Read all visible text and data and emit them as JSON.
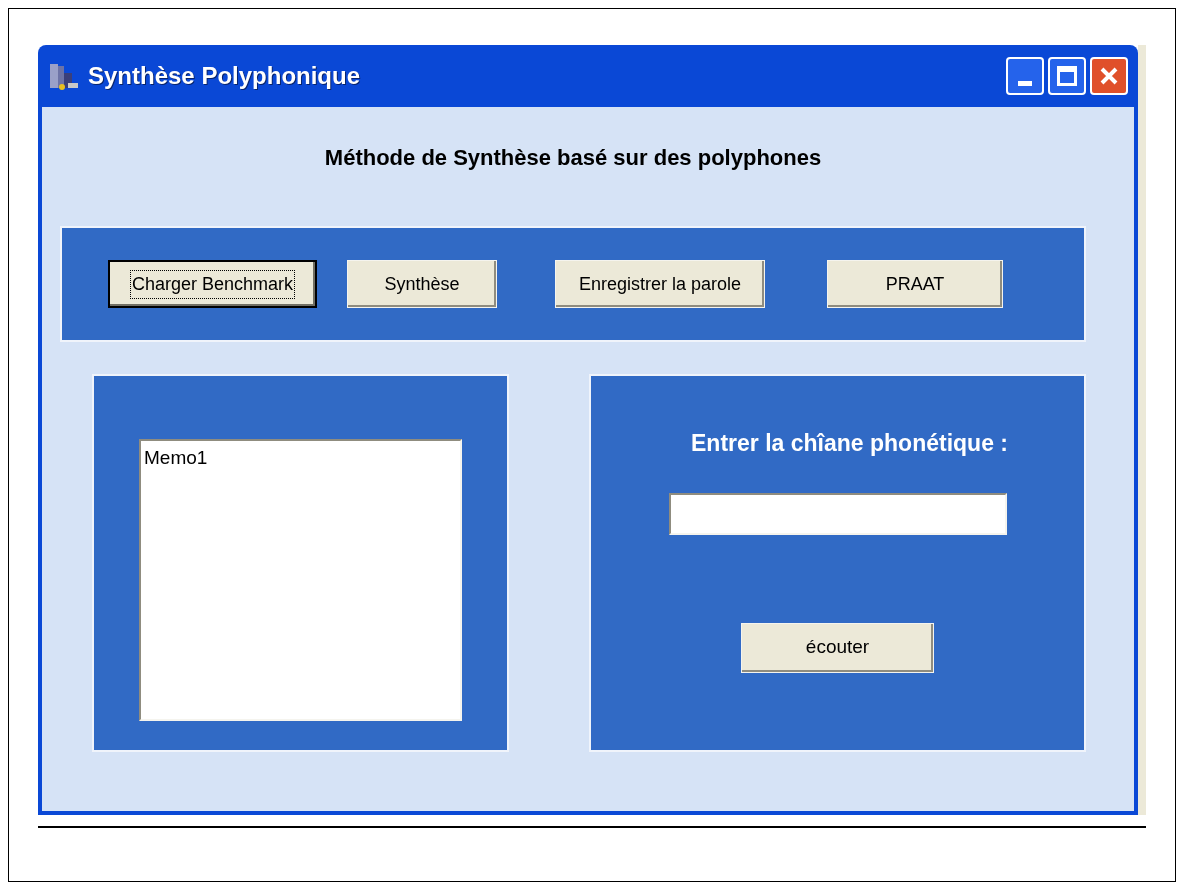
{
  "window": {
    "title": "Synthèse Polyphonique"
  },
  "heading": "Méthode de Synthèse basé sur des polyphones",
  "toolbar": {
    "buttons": [
      {
        "label": "Charger Benchmark",
        "focused": true
      },
      {
        "label": "Synthèse",
        "focused": false
      },
      {
        "label": "Enregistrer la parole",
        "focused": false
      },
      {
        "label": "PRAAT",
        "focused": false
      }
    ]
  },
  "memo": {
    "value": "Memo1"
  },
  "phonetic": {
    "label": "Entrer la chîane phonétique :",
    "listen_button": "écouter"
  }
}
